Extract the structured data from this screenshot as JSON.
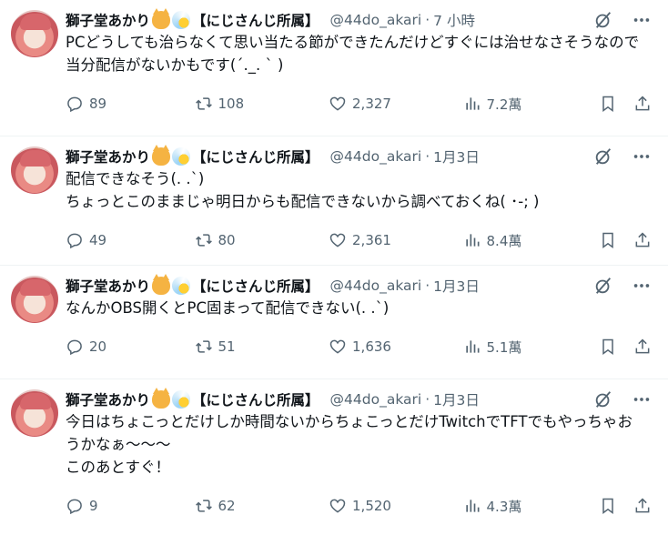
{
  "tweets": [
    {
      "name": "獅子堂あかり",
      "affiliation": "【にじさんじ所属】",
      "handle": "@44do_akari",
      "time": "7 小時",
      "text": "PCどうしても治らなくて思い当たる節ができたんだけどすぐには治せなさそうなので当分配信がないかもです(´._. ` )",
      "replies": "89",
      "retweets": "108",
      "likes": "2,327",
      "views": "7.2萬"
    },
    {
      "name": "獅子堂あかり",
      "affiliation": "【にじさんじ所属】",
      "handle": "@44do_akari",
      "time": "1月3日",
      "text": "配信できなそう(. .`)\nちょっとこのままじゃ明日からも配信できないから調べておくね( ･-; )",
      "replies": "49",
      "retweets": "80",
      "likes": "2,361",
      "views": "8.4萬"
    },
    {
      "name": "獅子堂あかり",
      "affiliation": "【にじさんじ所属】",
      "handle": "@44do_akari",
      "time": "1月3日",
      "text": "なんかOBS開くとPC固まって配信できない(. .`)",
      "replies": "20",
      "retweets": "51",
      "likes": "1,636",
      "views": "5.1萬"
    },
    {
      "name": "獅子堂あかり",
      "affiliation": "【にじさんじ所属】",
      "handle": "@44do_akari",
      "time": "1月3日",
      "text": "今日はちょこっとだけしか時間ないからちょこっとだけTwitchでTFTでもやっちゃおうかなぁ〜〜〜\nこのあとすぐ！",
      "replies": "9",
      "retweets": "62",
      "likes": "1,520",
      "views": "4.3萬"
    }
  ],
  "time_separator": "·",
  "icons": {
    "avatar": "avatar-image",
    "emoji1": "cat-face-emoji",
    "emoji2": "comet-emoji",
    "grok": "grok-icon",
    "more": "more-icon",
    "reply": "reply-icon",
    "retweet": "retweet-icon",
    "like": "heart-icon",
    "views": "views-icon",
    "bookmark": "bookmark-icon",
    "share": "share-icon"
  },
  "colors": {
    "text": "#0f1419",
    "secondary": "#536471",
    "divider": "#eff3f4"
  }
}
